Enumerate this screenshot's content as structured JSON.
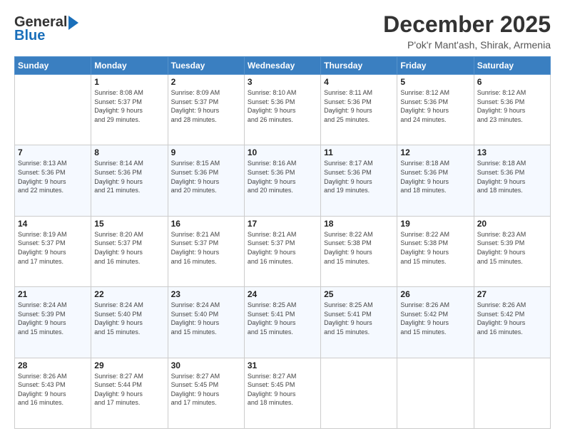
{
  "header": {
    "logo_general": "General",
    "logo_blue": "Blue",
    "title": "December 2025",
    "subtitle": "P'ok'r Mant'ash, Shirak, Armenia"
  },
  "days_of_week": [
    "Sunday",
    "Monday",
    "Tuesday",
    "Wednesday",
    "Thursday",
    "Friday",
    "Saturday"
  ],
  "weeks": [
    [
      {
        "day": "",
        "sunrise": "",
        "sunset": "",
        "daylight": ""
      },
      {
        "day": "1",
        "sunrise": "Sunrise: 8:08 AM",
        "sunset": "Sunset: 5:37 PM",
        "daylight": "Daylight: 9 hours and 29 minutes."
      },
      {
        "day": "2",
        "sunrise": "Sunrise: 8:09 AM",
        "sunset": "Sunset: 5:37 PM",
        "daylight": "Daylight: 9 hours and 28 minutes."
      },
      {
        "day": "3",
        "sunrise": "Sunrise: 8:10 AM",
        "sunset": "Sunset: 5:36 PM",
        "daylight": "Daylight: 9 hours and 26 minutes."
      },
      {
        "day": "4",
        "sunrise": "Sunrise: 8:11 AM",
        "sunset": "Sunset: 5:36 PM",
        "daylight": "Daylight: 9 hours and 25 minutes."
      },
      {
        "day": "5",
        "sunrise": "Sunrise: 8:12 AM",
        "sunset": "Sunset: 5:36 PM",
        "daylight": "Daylight: 9 hours and 24 minutes."
      },
      {
        "day": "6",
        "sunrise": "Sunrise: 8:12 AM",
        "sunset": "Sunset: 5:36 PM",
        "daylight": "Daylight: 9 hours and 23 minutes."
      }
    ],
    [
      {
        "day": "7",
        "sunrise": "Sunrise: 8:13 AM",
        "sunset": "Sunset: 5:36 PM",
        "daylight": "Daylight: 9 hours and 22 minutes."
      },
      {
        "day": "8",
        "sunrise": "Sunrise: 8:14 AM",
        "sunset": "Sunset: 5:36 PM",
        "daylight": "Daylight: 9 hours and 21 minutes."
      },
      {
        "day": "9",
        "sunrise": "Sunrise: 8:15 AM",
        "sunset": "Sunset: 5:36 PM",
        "daylight": "Daylight: 9 hours and 20 minutes."
      },
      {
        "day": "10",
        "sunrise": "Sunrise: 8:16 AM",
        "sunset": "Sunset: 5:36 PM",
        "daylight": "Daylight: 9 hours and 20 minutes."
      },
      {
        "day": "11",
        "sunrise": "Sunrise: 8:17 AM",
        "sunset": "Sunset: 5:36 PM",
        "daylight": "Daylight: 9 hours and 19 minutes."
      },
      {
        "day": "12",
        "sunrise": "Sunrise: 8:18 AM",
        "sunset": "Sunset: 5:36 PM",
        "daylight": "Daylight: 9 hours and 18 minutes."
      },
      {
        "day": "13",
        "sunrise": "Sunrise: 8:18 AM",
        "sunset": "Sunset: 5:36 PM",
        "daylight": "Daylight: 9 hours and 18 minutes."
      }
    ],
    [
      {
        "day": "14",
        "sunrise": "Sunrise: 8:19 AM",
        "sunset": "Sunset: 5:37 PM",
        "daylight": "Daylight: 9 hours and 17 minutes."
      },
      {
        "day": "15",
        "sunrise": "Sunrise: 8:20 AM",
        "sunset": "Sunset: 5:37 PM",
        "daylight": "Daylight: 9 hours and 16 minutes."
      },
      {
        "day": "16",
        "sunrise": "Sunrise: 8:21 AM",
        "sunset": "Sunset: 5:37 PM",
        "daylight": "Daylight: 9 hours and 16 minutes."
      },
      {
        "day": "17",
        "sunrise": "Sunrise: 8:21 AM",
        "sunset": "Sunset: 5:37 PM",
        "daylight": "Daylight: 9 hours and 16 minutes."
      },
      {
        "day": "18",
        "sunrise": "Sunrise: 8:22 AM",
        "sunset": "Sunset: 5:38 PM",
        "daylight": "Daylight: 9 hours and 15 minutes."
      },
      {
        "day": "19",
        "sunrise": "Sunrise: 8:22 AM",
        "sunset": "Sunset: 5:38 PM",
        "daylight": "Daylight: 9 hours and 15 minutes."
      },
      {
        "day": "20",
        "sunrise": "Sunrise: 8:23 AM",
        "sunset": "Sunset: 5:39 PM",
        "daylight": "Daylight: 9 hours and 15 minutes."
      }
    ],
    [
      {
        "day": "21",
        "sunrise": "Sunrise: 8:24 AM",
        "sunset": "Sunset: 5:39 PM",
        "daylight": "Daylight: 9 hours and 15 minutes."
      },
      {
        "day": "22",
        "sunrise": "Sunrise: 8:24 AM",
        "sunset": "Sunset: 5:40 PM",
        "daylight": "Daylight: 9 hours and 15 minutes."
      },
      {
        "day": "23",
        "sunrise": "Sunrise: 8:24 AM",
        "sunset": "Sunset: 5:40 PM",
        "daylight": "Daylight: 9 hours and 15 minutes."
      },
      {
        "day": "24",
        "sunrise": "Sunrise: 8:25 AM",
        "sunset": "Sunset: 5:41 PM",
        "daylight": "Daylight: 9 hours and 15 minutes."
      },
      {
        "day": "25",
        "sunrise": "Sunrise: 8:25 AM",
        "sunset": "Sunset: 5:41 PM",
        "daylight": "Daylight: 9 hours and 15 minutes."
      },
      {
        "day": "26",
        "sunrise": "Sunrise: 8:26 AM",
        "sunset": "Sunset: 5:42 PM",
        "daylight": "Daylight: 9 hours and 15 minutes."
      },
      {
        "day": "27",
        "sunrise": "Sunrise: 8:26 AM",
        "sunset": "Sunset: 5:42 PM",
        "daylight": "Daylight: 9 hours and 16 minutes."
      }
    ],
    [
      {
        "day": "28",
        "sunrise": "Sunrise: 8:26 AM",
        "sunset": "Sunset: 5:43 PM",
        "daylight": "Daylight: 9 hours and 16 minutes."
      },
      {
        "day": "29",
        "sunrise": "Sunrise: 8:27 AM",
        "sunset": "Sunset: 5:44 PM",
        "daylight": "Daylight: 9 hours and 17 minutes."
      },
      {
        "day": "30",
        "sunrise": "Sunrise: 8:27 AM",
        "sunset": "Sunset: 5:45 PM",
        "daylight": "Daylight: 9 hours and 17 minutes."
      },
      {
        "day": "31",
        "sunrise": "Sunrise: 8:27 AM",
        "sunset": "Sunset: 5:45 PM",
        "daylight": "Daylight: 9 hours and 18 minutes."
      },
      {
        "day": "",
        "sunrise": "",
        "sunset": "",
        "daylight": ""
      },
      {
        "day": "",
        "sunrise": "",
        "sunset": "",
        "daylight": ""
      },
      {
        "day": "",
        "sunrise": "",
        "sunset": "",
        "daylight": ""
      }
    ]
  ]
}
